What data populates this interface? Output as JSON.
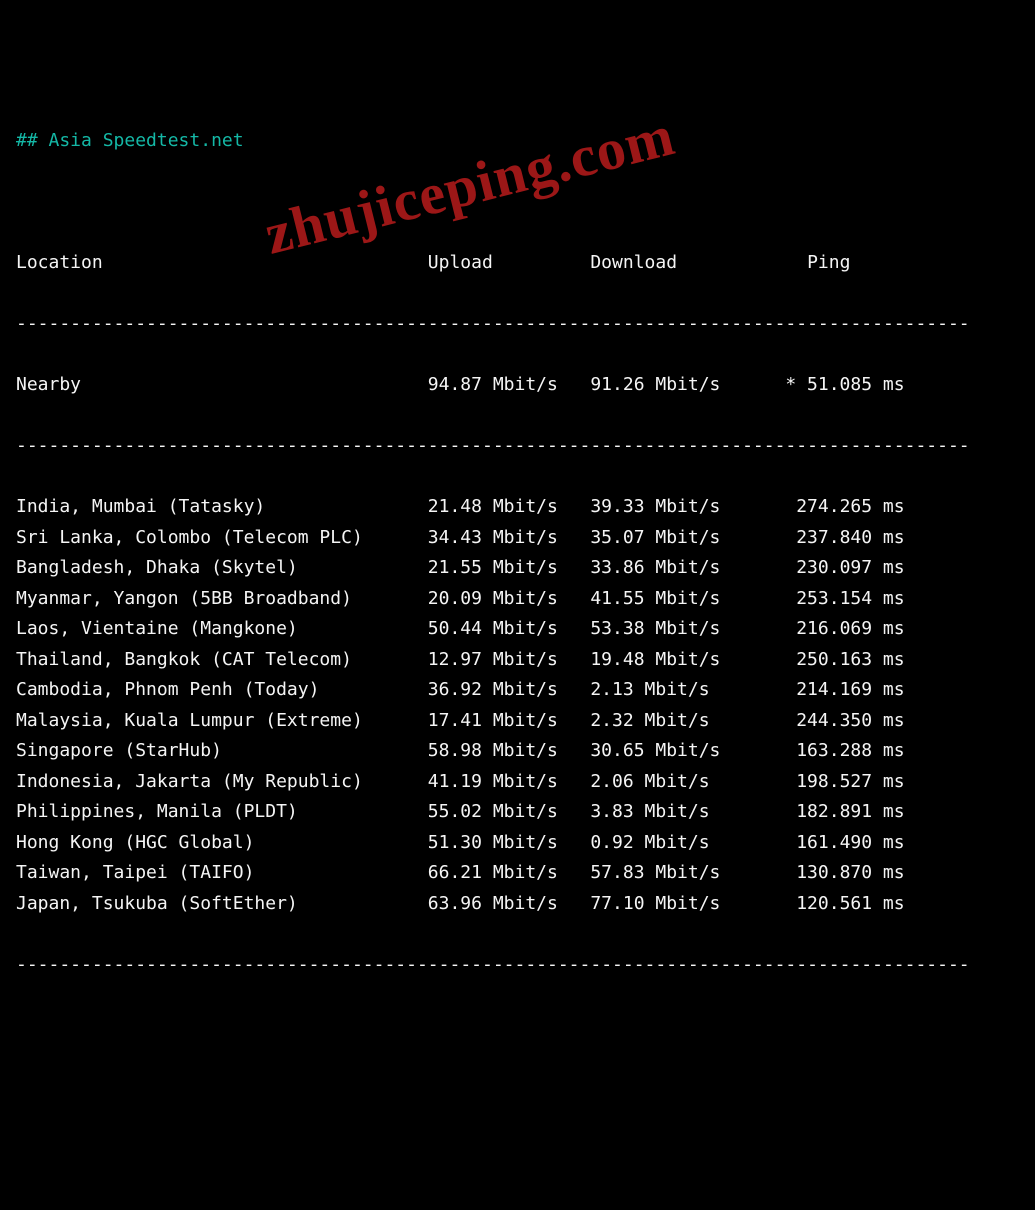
{
  "title": "## Asia Speedtest.net",
  "headers": {
    "location": "Location",
    "upload": "Upload",
    "download": "Download",
    "ping": "Ping"
  },
  "divider": "----------------------------------------------------------------------------------------",
  "nearby": {
    "location": "Nearby",
    "upload": "94.87 Mbit/s",
    "download": "91.26 Mbit/s",
    "ping": "* 51.085 ms"
  },
  "rows": [
    {
      "location": "India, Mumbai (Tatasky)",
      "upload": "21.48 Mbit/s",
      "download": "39.33 Mbit/s",
      "ping": "274.265 ms"
    },
    {
      "location": "Sri Lanka, Colombo (Telecom PLC)",
      "upload": "34.43 Mbit/s",
      "download": "35.07 Mbit/s",
      "ping": "237.840 ms"
    },
    {
      "location": "Bangladesh, Dhaka (Skytel)",
      "upload": "21.55 Mbit/s",
      "download": "33.86 Mbit/s",
      "ping": "230.097 ms"
    },
    {
      "location": "Myanmar, Yangon (5BB Broadband)",
      "upload": "20.09 Mbit/s",
      "download": "41.55 Mbit/s",
      "ping": "253.154 ms"
    },
    {
      "location": "Laos, Vientaine (Mangkone)",
      "upload": "50.44 Mbit/s",
      "download": "53.38 Mbit/s",
      "ping": "216.069 ms"
    },
    {
      "location": "Thailand, Bangkok (CAT Telecom)",
      "upload": "12.97 Mbit/s",
      "download": "19.48 Mbit/s",
      "ping": "250.163 ms"
    },
    {
      "location": "Cambodia, Phnom Penh (Today)",
      "upload": "36.92 Mbit/s",
      "download": "2.13 Mbit/s",
      "ping": "214.169 ms"
    },
    {
      "location": "Malaysia, Kuala Lumpur (Extreme)",
      "upload": "17.41 Mbit/s",
      "download": "2.32 Mbit/s",
      "ping": "244.350 ms"
    },
    {
      "location": "Singapore (StarHub)",
      "upload": "58.98 Mbit/s",
      "download": "30.65 Mbit/s",
      "ping": "163.288 ms"
    },
    {
      "location": "Indonesia, Jakarta (My Republic)",
      "upload": "41.19 Mbit/s",
      "download": "2.06 Mbit/s",
      "ping": "198.527 ms"
    },
    {
      "location": "Philippines, Manila (PLDT)",
      "upload": "55.02 Mbit/s",
      "download": "3.83 Mbit/s",
      "ping": "182.891 ms"
    },
    {
      "location": "Hong Kong (HGC Global)",
      "upload": "51.30 Mbit/s",
      "download": "0.92 Mbit/s",
      "ping": "161.490 ms"
    },
    {
      "location": "Taiwan, Taipei (TAIFO)",
      "upload": "66.21 Mbit/s",
      "download": "57.83 Mbit/s",
      "ping": "130.870 ms"
    },
    {
      "location": "Japan, Tsukuba (SoftEther)",
      "upload": "63.96 Mbit/s",
      "download": "77.10 Mbit/s",
      "ping": "120.561 ms"
    }
  ],
  "watermark": "zhujiceping.com"
}
